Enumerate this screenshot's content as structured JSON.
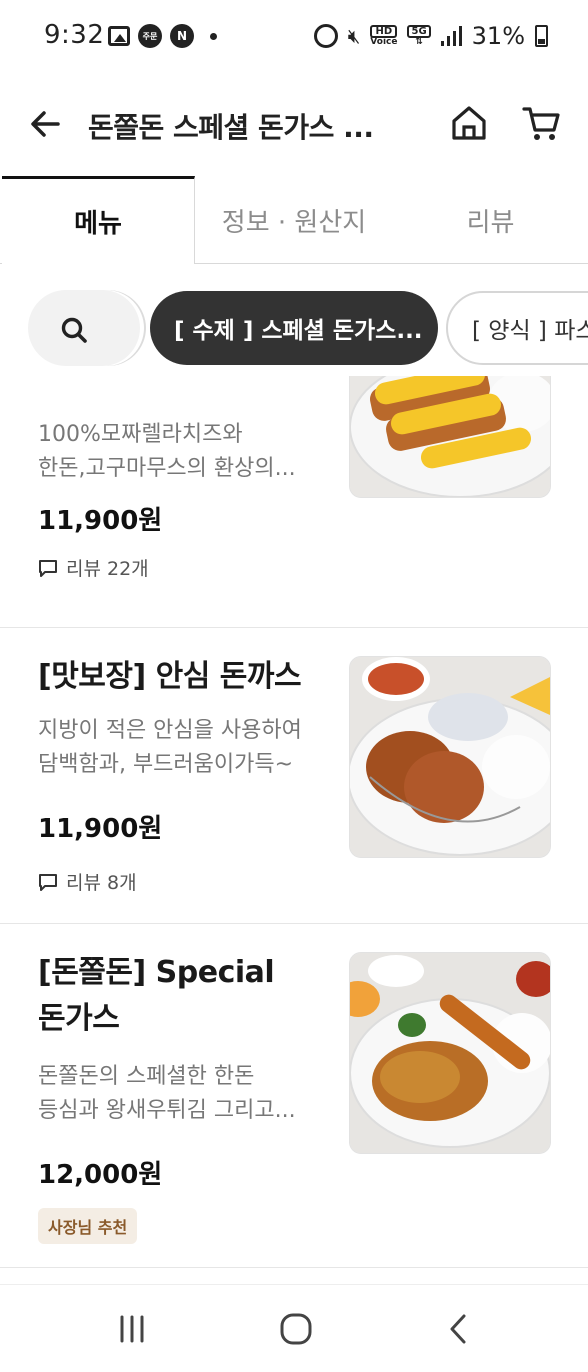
{
  "status_bar": {
    "time": "9:32",
    "badge_1": "주문",
    "badge_2": "N",
    "hd_top": "HD",
    "hd_bottom": "Voice",
    "net": "5G",
    "battery_pct": "31%"
  },
  "app_bar": {
    "title": "돈쫄돈 스페셜 돈가스 ..."
  },
  "tabs": [
    {
      "label": "메뉴",
      "active": true
    },
    {
      "label": "정보 · 원산지",
      "active": false
    },
    {
      "label": "리뷰",
      "active": false
    }
  ],
  "chips": [
    {
      "label": "[ 수제 ] 스페셜 돈가스...",
      "active": true
    },
    {
      "label": "[ 양식 ] 파스",
      "active": false
    }
  ],
  "menu_items": [
    {
      "name": "",
      "desc_line1": "100%모짜렐라치즈와",
      "desc_line2": "한돈,고구마무스의 환상의...",
      "price": "11,900원",
      "review": "리뷰 22개"
    },
    {
      "name": "[맛보장] 안심 돈까스",
      "desc_line1": "지방이 적은 안심을 사용하여",
      "desc_line2": "담백함과, 부드러움이가득~",
      "price": "11,900원",
      "review": "리뷰 8개"
    },
    {
      "name_line1": "[돈쫄돈] Special",
      "name_line2": "돈가스",
      "desc_line1": "돈쫄돈의 스페셜한 한돈",
      "desc_line2": "등심과 왕새우튀김 그리고...",
      "price": "12,000원",
      "badge": "사장님 추천"
    }
  ],
  "colors": {
    "accent_chip": "#333333",
    "badge_bg": "#f4ede4",
    "badge_text": "#8a5a2b"
  }
}
